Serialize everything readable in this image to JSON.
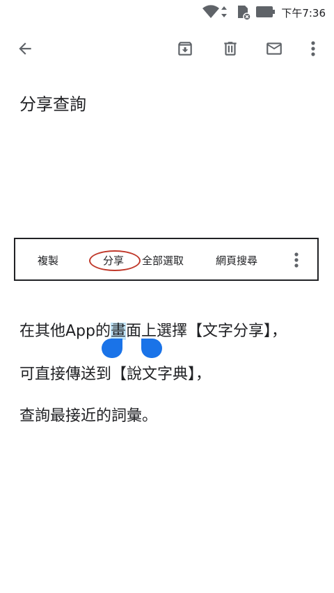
{
  "status_bar": {
    "time": "下午7:36",
    "icons": [
      "wifi-icon",
      "sim-card-icon",
      "battery-icon"
    ]
  },
  "toolbar": {
    "icons": [
      "back-arrow-icon",
      "archive-icon",
      "delete-icon",
      "mail-icon",
      "more-vert-icon"
    ]
  },
  "message": {
    "subject": "分享查詢",
    "lines": {
      "line1_before": "在其他App的",
      "line1_selected": "畫",
      "line1_after": "面上選擇【文字分享】，",
      "line2": "可直接傳送到【說文字典】，",
      "line3": "查詢最接近的詞彙。"
    }
  },
  "selection_menu": {
    "items": [
      "複製",
      "分享",
      "全部選取",
      "網頁搜尋"
    ],
    "highlighted": "分享",
    "highlight_color": "#c0392b"
  },
  "colors": {
    "selection_highlight": "#bfe2f5",
    "handle": "#1a73e8"
  }
}
